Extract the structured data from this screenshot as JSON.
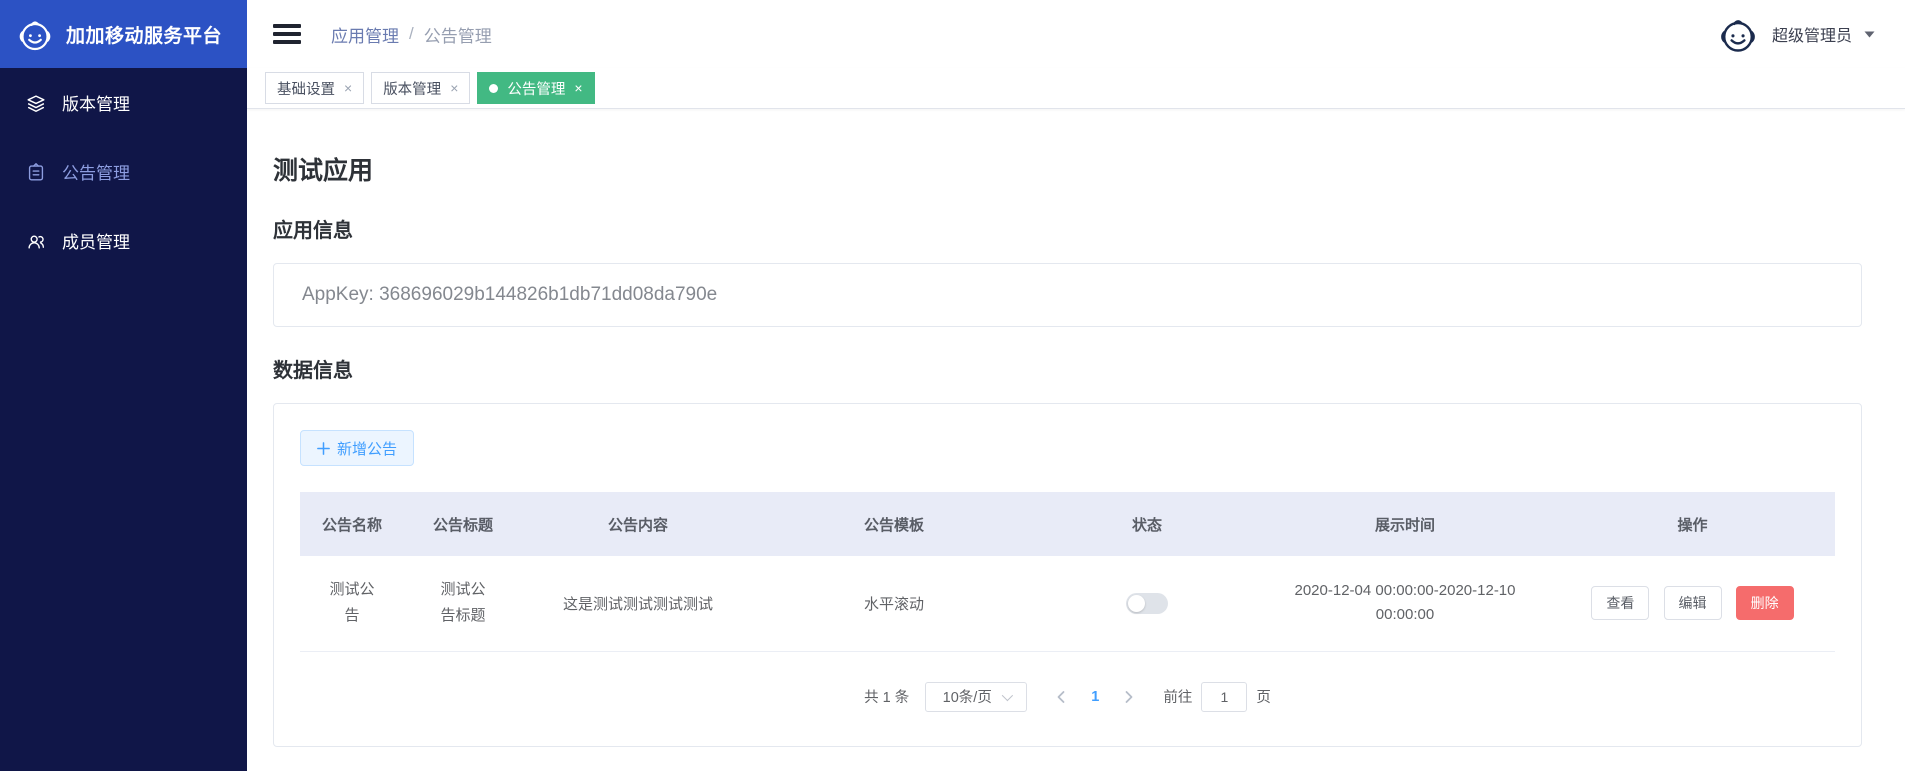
{
  "app": {
    "title": "加加移动服务平台"
  },
  "sidebar": {
    "items": [
      {
        "label": "版本管理",
        "icon": "layers-icon",
        "active": false
      },
      {
        "label": "公告管理",
        "icon": "clipboard-icon",
        "active": true
      },
      {
        "label": "成员管理",
        "icon": "users-icon",
        "active": false
      }
    ]
  },
  "header": {
    "breadcrumb": {
      "parent": "应用管理",
      "separator": "/",
      "current": "公告管理"
    },
    "user": {
      "name": "超级管理员",
      "icon": "avatar-smiley-icon"
    }
  },
  "tabs": [
    {
      "label": "基础设置",
      "close": "×",
      "active": false
    },
    {
      "label": "版本管理",
      "close": "×",
      "active": false
    },
    {
      "label": "公告管理",
      "close": "×",
      "active": true
    }
  ],
  "main": {
    "page_title": "测试应用",
    "app_info": {
      "heading": "应用信息",
      "appkey": "AppKey: 368696029b144826b1db71dd08da790e"
    },
    "data_info": {
      "heading": "数据信息",
      "add_button": {
        "label": "新增公告",
        "icon": "plus-icon"
      },
      "table": {
        "columns": [
          "公告名称",
          "公告标题",
          "公告内容",
          "公告模板",
          "状态",
          "展示时间",
          "操作"
        ],
        "rows": [
          {
            "name": "测试公告",
            "title": "测试公告标题",
            "content": "这是测试测试测试测试",
            "template": "水平滚动",
            "status_on": false,
            "display_time": "2020-12-04 00:00:00-2020-12-10 00:00:00",
            "actions": {
              "view": "查看",
              "edit": "编辑",
              "delete": "删除"
            }
          }
        ]
      },
      "pagination": {
        "total": "共 1 条",
        "page_size": "10条/页",
        "current_page": "1",
        "goto_label": "前往",
        "goto_value": "1",
        "goto_unit": "页"
      }
    }
  },
  "colors": {
    "sidebar_bg": "#101648",
    "logo_bg": "#2c52c4",
    "active_tab_green": "#42b983",
    "primary_blue": "#409eff",
    "danger_red": "#f56c6c",
    "table_header_bg": "#e8ebf7"
  }
}
